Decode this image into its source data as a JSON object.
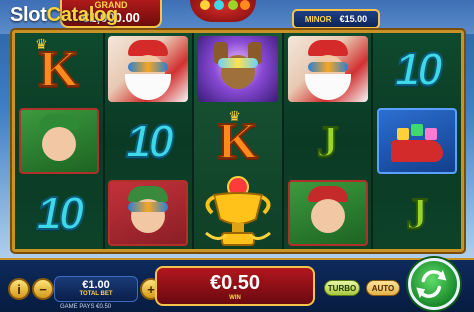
{
  "watermark": {
    "slot": "Slot",
    "catalog": "Catalog"
  },
  "jackpots": {
    "grand": {
      "label": "GRAND",
      "value": "€1,000.00"
    },
    "minor": {
      "label": "MINOR",
      "value": "€15.00"
    }
  },
  "reels": [
    [
      "K",
      "elf",
      "10"
    ],
    [
      "santa",
      "10",
      "elf-girl"
    ],
    [
      "reindeer",
      "K",
      "trophy"
    ],
    [
      "santa",
      "J",
      "elf"
    ],
    [
      "10",
      "sleigh",
      "J"
    ]
  ],
  "bottom_bar": {
    "info_button": "i",
    "minus_button": "−",
    "plus_button": "+",
    "bet_value": "€1.00",
    "bet_label": "TOTAL BET",
    "game_pays": "GAME PAYS €0.50",
    "win_value": "€0.50",
    "win_label": "WIN",
    "turbo_label": "TURBO",
    "auto_label": "AUTO"
  },
  "colors": {
    "frame_gold": "#c89224",
    "reel_green": "#0f4a2e",
    "spin_green": "#1a8a2a",
    "win_red": "#b3161e"
  }
}
